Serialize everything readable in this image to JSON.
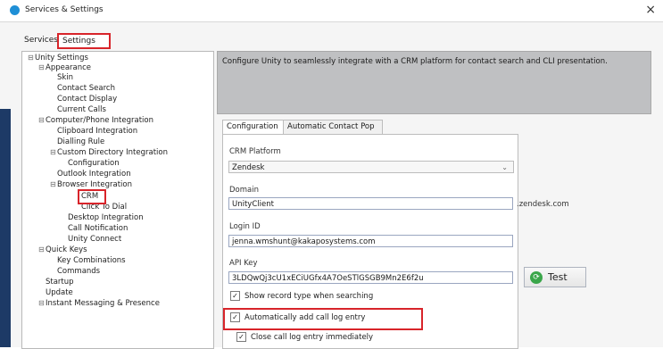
{
  "window": {
    "title": "Services & Settings",
    "close": "×"
  },
  "tabs": [
    "Services",
    "Settings"
  ],
  "tree": [
    {
      "label": "Unity Settings",
      "tog": "⊟"
    },
    {
      "label": "Appearance",
      "tog": "⊟"
    },
    {
      "label": "Skin"
    },
    {
      "label": "Contact Search"
    },
    {
      "label": "Contact Display"
    },
    {
      "label": "Current Calls"
    },
    {
      "label": "Computer/Phone Integration",
      "tog": "⊟"
    },
    {
      "label": "Clipboard Integration"
    },
    {
      "label": "Dialling Rule"
    },
    {
      "label": "Custom Directory Integration",
      "tog": "⊟"
    },
    {
      "label": "Configuration"
    },
    {
      "label": "Outlook Integration"
    },
    {
      "label": "Browser Integration",
      "tog": "⊟"
    },
    {
      "label": "CRM"
    },
    {
      "label": "Click To Dial"
    },
    {
      "label": "Desktop Integration"
    },
    {
      "label": "Call Notification"
    },
    {
      "label": "Unity Connect"
    },
    {
      "label": "Quick Keys",
      "tog": "⊟"
    },
    {
      "label": "Key Combinations"
    },
    {
      "label": "Commands"
    },
    {
      "label": "Startup"
    },
    {
      "label": "Update"
    },
    {
      "label": "Instant Messaging & Presence",
      "tog": "⊟"
    }
  ],
  "description": "Configure Unity to seamlessly integrate with a CRM platform for contact search and CLI presentation.",
  "subtabs": [
    "Configuration",
    "Automatic Contact Pop"
  ],
  "form": {
    "crm_label": "CRM Platform",
    "crm_value": "Zendesk",
    "domain_label": "Domain",
    "domain_value": "UnityClient",
    "domain_suffix": ".zendesk.com",
    "login_label": "Login ID",
    "login_value": "jenna.wmshunt@kakaposystems.com",
    "api_label": "API Key",
    "api_value": "3LDQwQj3cU1xECiUGfx4A7OeSTlGSGB9Mn2E6f2u",
    "test_label": "Test",
    "show_record": "Show record type when searching",
    "auto_add": "Automatically add call log entry",
    "close_call": "Close call log entry immediately"
  }
}
